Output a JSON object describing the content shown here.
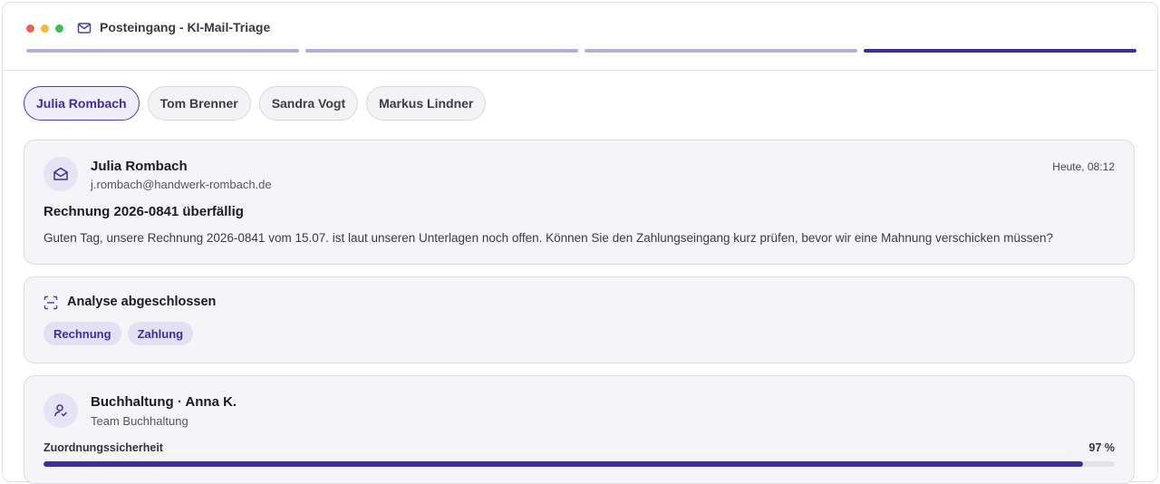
{
  "window": {
    "title": "Posteingang - KI-Mail-Triage",
    "dot_colors": [
      "#ee5f57",
      "#f5b93a",
      "#37c24a"
    ],
    "progress_steps_total": 4,
    "progress_active_step": 4
  },
  "contacts": [
    {
      "label": "Julia Rombach",
      "selected": true
    },
    {
      "label": "Tom Brenner",
      "selected": false
    },
    {
      "label": "Sandra Vogt",
      "selected": false
    },
    {
      "label": "Markus Lindner",
      "selected": false
    }
  ],
  "email": {
    "sender_name": "Julia Rombach",
    "sender_email": "j.rombach@handwerk-rombach.de",
    "time": "Heute, 08:12",
    "subject": "Rechnung 2026-0841 überfällig",
    "body": "Guten Tag, unsere Rechnung 2026-0841 vom 15.07. ist laut unseren Unterlagen noch offen. Können Sie den Zahlungseingang kurz prüfen, bevor wir eine Mahnung verschicken müssen?",
    "icon": "envelope-open-icon"
  },
  "analysis": {
    "title": "Analyse abgeschlossen",
    "icon": "scan-icon",
    "tags": [
      "Rechnung",
      "Zahlung"
    ]
  },
  "assignment": {
    "name": "Buchhaltung · Anna K.",
    "team": "Team Buchhaltung",
    "icon": "user-check-icon",
    "confidence_label": "Zuordnungssicherheit",
    "confidence_value": "97 %",
    "confidence_fraction": 0.97
  },
  "colors": {
    "accent": "#3b2f9a",
    "accent_light": "#b5abdc",
    "card_bg": "#f5f5f8"
  }
}
